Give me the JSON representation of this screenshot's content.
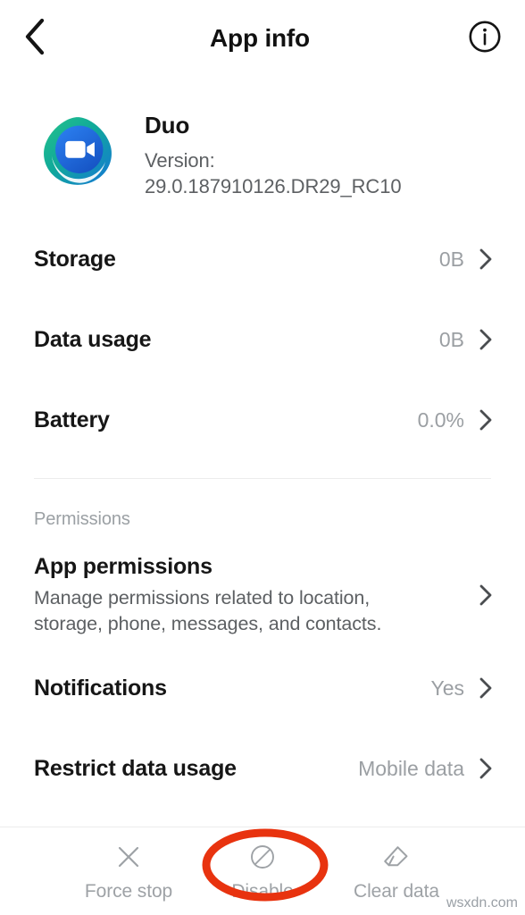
{
  "header": {
    "title": "App info",
    "back_icon": "chevron-left-icon",
    "info_icon": "info-circle-icon"
  },
  "app": {
    "name": "Duo",
    "icon": "duo-app-icon",
    "version_label": "Version:",
    "version_value": "29.0.187910126.DR29_RC10"
  },
  "usage_rows": [
    {
      "title": "Storage",
      "value": "0B"
    },
    {
      "title": "Data usage",
      "value": "0B"
    },
    {
      "title": "Battery",
      "value": "0.0%"
    }
  ],
  "permissions_section": {
    "label": "Permissions",
    "rows": [
      {
        "title": "App permissions",
        "subtitle": "Manage permissions related to location, storage, phone, messages, and contacts.",
        "value": ""
      },
      {
        "title": "Notifications",
        "subtitle": "",
        "value": "Yes"
      },
      {
        "title": "Restrict data usage",
        "subtitle": "",
        "value": "Mobile data"
      }
    ]
  },
  "bottom_actions": [
    {
      "label": "Force stop",
      "icon": "close-x-icon"
    },
    {
      "label": "Disable",
      "icon": "block-circle-slash-icon"
    },
    {
      "label": "Clear data",
      "icon": "eraser-icon"
    }
  ],
  "annotation": {
    "shape": "ellipse-highlight",
    "target": "Disable",
    "color": "#E8330F"
  },
  "watermark": "wsxdn.com",
  "colors": {
    "background": "#ffffff",
    "title": "#111111",
    "secondary_text": "#5d6063",
    "muted_text": "#9ea2a6",
    "divider": "#ececec",
    "annotation_red": "#E8330F",
    "icon_teal": "#18b58a",
    "icon_green": "#0fa88f",
    "icon_blue": "#1a73e8",
    "icon_deep_blue": "#1359c6"
  }
}
